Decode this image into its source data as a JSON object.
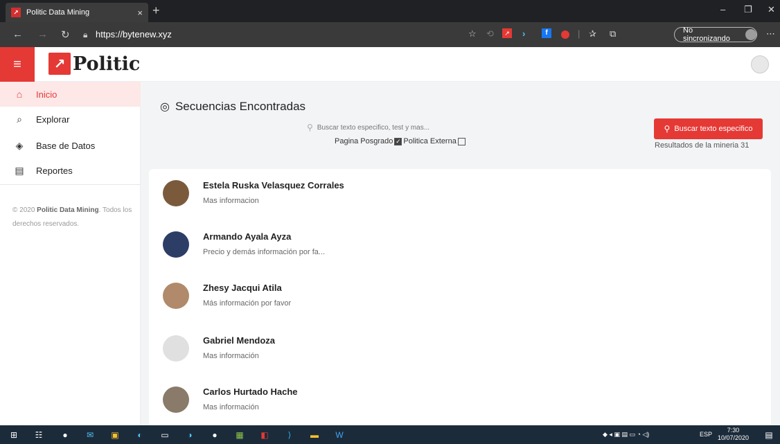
{
  "browser": {
    "tab_title": "Politic Data Mining",
    "tab_close": "×",
    "new_tab": "+",
    "url": "https://bytenew.xyz",
    "sync_label": "No sincronizando",
    "icons": [
      "back-icon",
      "forward-icon",
      "refresh-icon",
      "lock-icon",
      "star-icon",
      "share-icon",
      "ext-politic-icon",
      "ext-arrow-icon",
      "ext-facebook-icon",
      "ext-red-icon",
      "favorites-icon",
      "collections-icon",
      "more-icon"
    ]
  },
  "app": {
    "logo_text": "Politic",
    "brand_color": "#e53935"
  },
  "sidebar": {
    "items": [
      {
        "label": "Inicio",
        "icon": "home-icon",
        "active": true
      },
      {
        "label": "Explorar",
        "icon": "search-icon",
        "active": false
      },
      {
        "label": "Base de Datos",
        "icon": "layers-icon",
        "active": false
      },
      {
        "label": "Reportes",
        "icon": "clipboard-icon",
        "active": false
      }
    ],
    "copyright_prefix": "© 2020 ",
    "copyright_brand": "Politic Data Mining",
    "copyright_suffix": ". Todos los derechos reservados."
  },
  "main": {
    "title": "Secuencias Encontradas",
    "search_placeholder": "Buscar texto especifico, test y mas...",
    "filter_posgrado": "Pagina Posgrado",
    "filter_posgrado_checked": true,
    "filter_externa": "Politica Externa",
    "filter_externa_checked": false,
    "search_button": "Buscar texto especifico",
    "results_label": "Resultados de la mineria 31"
  },
  "people": [
    {
      "name": "Estela Ruska Velasquez Corrales",
      "message": "Mas informacion",
      "avatar_color": "#7b5a3c"
    },
    {
      "name": "Armando Ayala Ayza",
      "message": "Precio y demás información por fa...",
      "avatar_color": "#2c3e66"
    },
    {
      "name": "Zhesy Jacqui Atila",
      "message": "Más información por favor",
      "avatar_color": "#b08a6a"
    },
    {
      "name": "Gabriel Mendoza",
      "message": "Mas información",
      "avatar_color": "#e0e0e0"
    },
    {
      "name": "Carlos Hurtado Hache",
      "message": "Mas información",
      "avatar_color": "#8a7a6a"
    }
  ],
  "taskbar": {
    "lang": "ESP",
    "time": "7:30",
    "date": "10/07/2020"
  }
}
